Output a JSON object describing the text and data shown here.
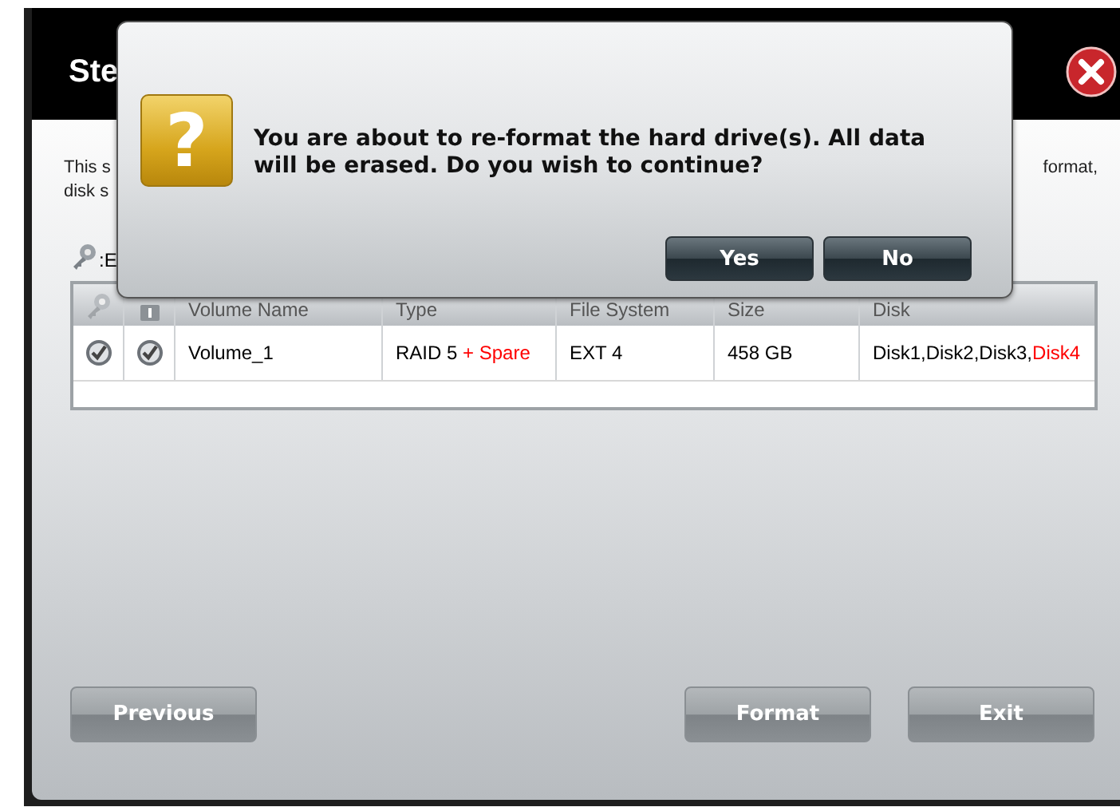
{
  "window": {
    "title": "Ste"
  },
  "intro": {
    "left_lines": [
      "This s",
      "disk s"
    ],
    "right_text": "format,"
  },
  "legend": {
    "text": ":E"
  },
  "table": {
    "columns": [
      "Volume Name",
      "Type",
      "File System",
      "Size",
      "Disk"
    ],
    "rows": [
      {
        "volume_name": "Volume_1",
        "type": [
          {
            "text": "RAID 5 ",
            "color": "#000000"
          },
          {
            "text": "+ Spare",
            "color": "#ff0000"
          }
        ],
        "file_system": "EXT 4",
        "size": "458 GB",
        "disk": [
          {
            "text": "Disk1,Disk2,Disk3,",
            "color": "#000000"
          },
          {
            "text": "Disk4",
            "color": "#ff0000"
          }
        ]
      }
    ]
  },
  "buttons": {
    "left": [
      "Previous"
    ],
    "right": [
      "Format",
      "Exit"
    ]
  },
  "dialog": {
    "icon": "?",
    "message": "You are about to re-format the hard drive(s). All data will be erased. Do you wish to continue?",
    "buttons": [
      "Yes",
      "No"
    ]
  }
}
